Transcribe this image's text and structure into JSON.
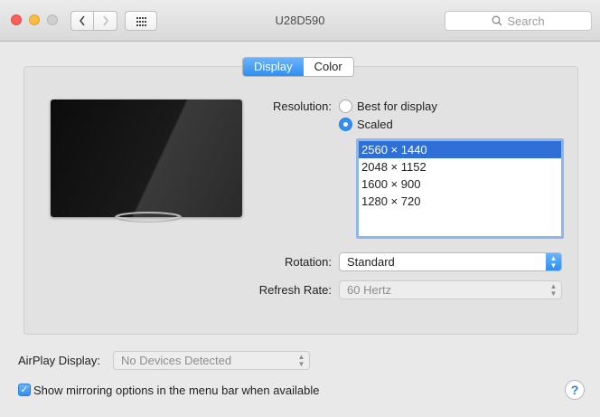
{
  "window": {
    "title": "U28D590"
  },
  "toolbar": {
    "back_icon": "chevron-left-icon",
    "forward_icon": "chevron-right-icon",
    "grid_icon": "grid-icon",
    "search_placeholder": "Search"
  },
  "tabs": [
    {
      "label": "Display",
      "active": true
    },
    {
      "label": "Color",
      "active": false
    }
  ],
  "display": {
    "resolution_label": "Resolution:",
    "options": [
      {
        "label": "Best for display",
        "selected": false
      },
      {
        "label": "Scaled",
        "selected": true
      }
    ],
    "scaled_resolutions": [
      "2560 × 1440",
      "2048 × 1152",
      "1600 × 900",
      "1280 × 720"
    ],
    "selected_resolution": "2560 × 1440",
    "rotation_label": "Rotation:",
    "rotation_value": "Standard",
    "refresh_label": "Refresh Rate:",
    "refresh_value": "60 Hertz"
  },
  "airplay": {
    "label": "AirPlay Display:",
    "value": "No Devices Detected"
  },
  "mirroring": {
    "label": "Show mirroring options in the menu bar when available",
    "checked": true
  },
  "help_label": "?",
  "colors": {
    "accent": "#2d8ff3",
    "selection": "#2f6fd7",
    "close": "#fc605c",
    "minimize": "#fdbc40"
  }
}
